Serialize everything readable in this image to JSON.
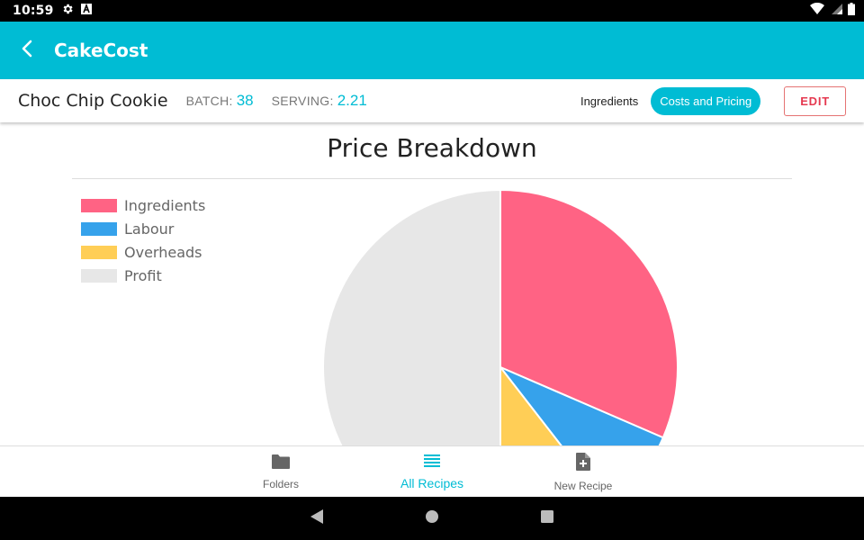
{
  "status_bar": {
    "time": "10:59",
    "icons": [
      "settings-icon",
      "a-badge-icon",
      "wifi-icon",
      "signal-icon",
      "battery-icon"
    ]
  },
  "app_bar": {
    "title": "CakeCost",
    "back_icon": "back-arrow-icon"
  },
  "recipe_header": {
    "name": "Choc Chip Cookie",
    "batch_label": "BATCH:",
    "batch_value": "38",
    "serving_label": "SERVING:",
    "serving_value": "2.21",
    "tabs": [
      {
        "label": "Ingredients",
        "active": false
      },
      {
        "label": "Costs and Pricing",
        "active": true
      }
    ],
    "edit_label": "EDIT"
  },
  "chart_data": {
    "type": "pie",
    "title": "Price Breakdown",
    "legend_position": "top-left",
    "series": [
      {
        "name": "Ingredients",
        "value": 31.5,
        "color": "#FF6384"
      },
      {
        "name": "Labour",
        "value": 8.0,
        "color": "#36A2EB"
      },
      {
        "name": "Overheads",
        "value": 10.5,
        "color": "#FFCE56"
      },
      {
        "name": "Profit",
        "value": 50.0,
        "color": "#E7E7E7"
      }
    ]
  },
  "bottom_nav": [
    {
      "label": "Folders",
      "icon": "folder-icon",
      "active": false
    },
    {
      "label": "All Recipes",
      "icon": "list-icon",
      "active": true
    },
    {
      "label": "New Recipe",
      "icon": "new-file-icon",
      "active": false
    }
  ],
  "colors": {
    "accent": "#00BCD4",
    "edit": "#E53950"
  }
}
